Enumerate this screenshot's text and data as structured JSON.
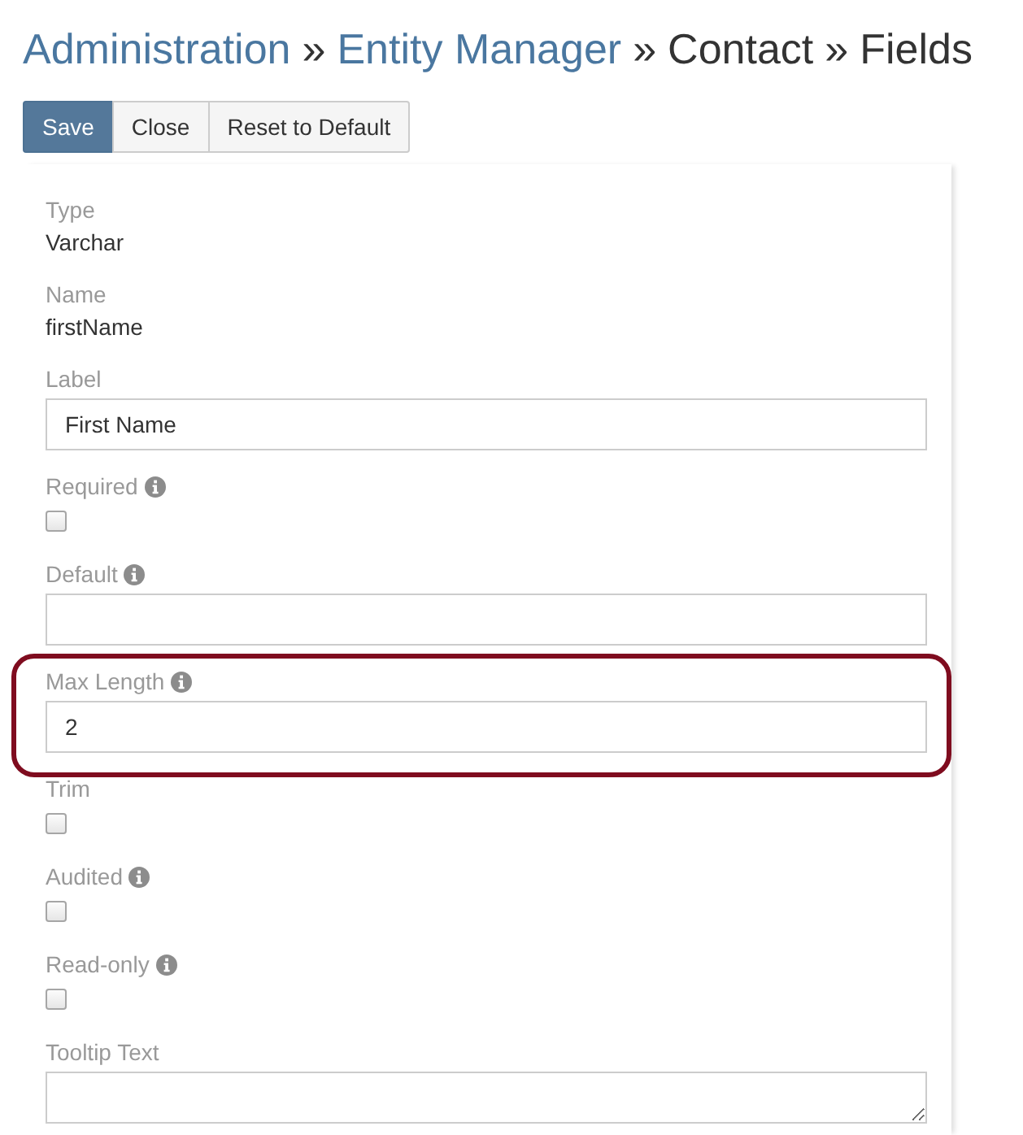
{
  "breadcrumb": {
    "separator": "»",
    "items": [
      {
        "label": "Administration",
        "kind": "link"
      },
      {
        "label": "Entity Manager",
        "kind": "link"
      },
      {
        "label": "Contact",
        "kind": "current"
      },
      {
        "label": "Fields",
        "kind": "current"
      }
    ]
  },
  "buttons": [
    {
      "label": "Save",
      "kind": "primary"
    },
    {
      "label": "Close",
      "kind": "default"
    },
    {
      "label": "Reset to Default",
      "kind": "default"
    }
  ],
  "fields": [
    {
      "kind": "static",
      "label": "Type",
      "value": "Varchar",
      "info": false,
      "highlighted": false
    },
    {
      "kind": "static",
      "label": "Name",
      "value": "firstName",
      "info": false,
      "highlighted": false
    },
    {
      "kind": "input",
      "label": "Label",
      "value": "First Name",
      "info": false,
      "highlighted": false
    },
    {
      "kind": "checkbox",
      "label": "Required",
      "checked": false,
      "info": true,
      "highlighted": false
    },
    {
      "kind": "input",
      "label": "Default",
      "info": true,
      "highlighted": false
    },
    {
      "kind": "input",
      "label": "Max Length",
      "value": "2",
      "info": true,
      "highlighted": true
    },
    {
      "kind": "checkbox",
      "label": "Trim",
      "checked": false,
      "info": false,
      "highlighted": false
    },
    {
      "kind": "checkbox",
      "label": "Audited",
      "checked": false,
      "info": true,
      "highlighted": false
    },
    {
      "kind": "checkbox",
      "label": "Read-only",
      "checked": false,
      "info": true,
      "highlighted": false
    },
    {
      "kind": "textarea",
      "label": "Tooltip Text",
      "info": false,
      "highlighted": false
    }
  ]
}
